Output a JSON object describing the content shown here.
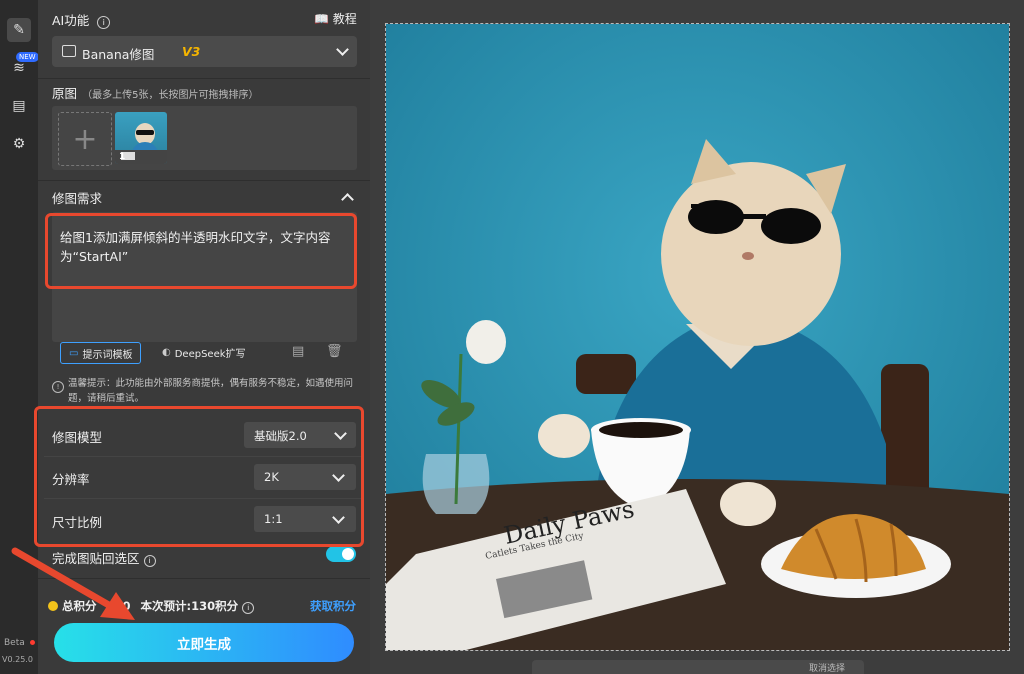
{
  "rail": {
    "new_badge": "NEW",
    "beta": "Beta",
    "version": "V0.25.0"
  },
  "header": {
    "title": "AI功能",
    "tutorial": "教程"
  },
  "feature_select": {
    "label": "Banana修图",
    "version": "V3"
  },
  "original": {
    "title": "原图",
    "hint": "（最多上传5张，长按图片可拖拽排序）",
    "add": "+",
    "thumb_index": "1"
  },
  "edit": {
    "title": "修图需求",
    "prompt": "给图1添加满屏倾斜的半透明水印文字，文字内容为“StartAI”",
    "template_button": "提示词模板",
    "deepseek_button": "DeepSeek扩写",
    "tip": "温馨提示：此功能由外部服务商提供，偶有服务不稳定，如遇使用问题，请稍后重试。"
  },
  "settings": {
    "model_label": "修图模型",
    "model_value": "基础版2.0",
    "resolution_label": "分辨率",
    "resolution_value": "2K",
    "ratio_label": "尺寸比例",
    "ratio_value": "1:1",
    "paste_back_label": "完成图贴回选区"
  },
  "credits": {
    "total_label": "总积分",
    "total_value": "540",
    "estimate": "本次预计:130积分",
    "get": "获取积分"
  },
  "generate_button": "立即生成",
  "canvas": {
    "newspaper_title": "Daily Paws",
    "newspaper_sub": "Catlets Takes the City",
    "bottom_hint": "取消选择"
  },
  "colors": {
    "accent": "#2f8cff",
    "highlight_border": "#e8482e",
    "toggle_on": "#22c3e6",
    "version_tag": "#f4b400"
  }
}
